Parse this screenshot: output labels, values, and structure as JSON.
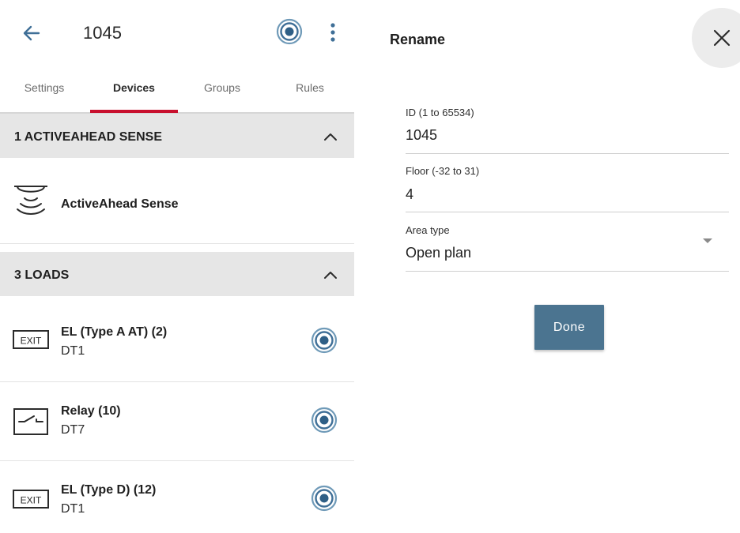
{
  "header": {
    "title": "1045"
  },
  "tabs": [
    {
      "label": "Settings",
      "active": false
    },
    {
      "label": "Devices",
      "active": true
    },
    {
      "label": "Groups",
      "active": false
    },
    {
      "label": "Rules",
      "active": false
    }
  ],
  "sections": [
    {
      "title": "1 ACTIVEAHEAD SENSE",
      "items": [
        {
          "title": "ActiveAhead Sense",
          "icon": "sensor-icon"
        }
      ]
    },
    {
      "title": "3 LOADS",
      "items": [
        {
          "title": "EL (Type A AT) (2)",
          "subtitle": "DT1",
          "icon": "exit-sign-icon",
          "exit_label": "EXIT"
        },
        {
          "title": "Relay (10)",
          "subtitle": "DT7",
          "icon": "relay-icon"
        },
        {
          "title": "EL (Type D) (12)",
          "subtitle": "DT1",
          "icon": "exit-sign-icon",
          "exit_label": "EXIT"
        }
      ]
    }
  ],
  "dialog": {
    "title": "Rename",
    "fields": [
      {
        "label": "ID (1 to 65534)",
        "value": "1045"
      },
      {
        "label": "Floor (-32 to 31)",
        "value": "4"
      },
      {
        "label": "Area type",
        "value": "Open plan"
      }
    ],
    "done_label": "Done"
  },
  "colors": {
    "accent_red": "#c8102e",
    "nav_blue": "#3f6f97",
    "button_blue": "#4b7490",
    "section_bg": "#e6e6e6"
  }
}
